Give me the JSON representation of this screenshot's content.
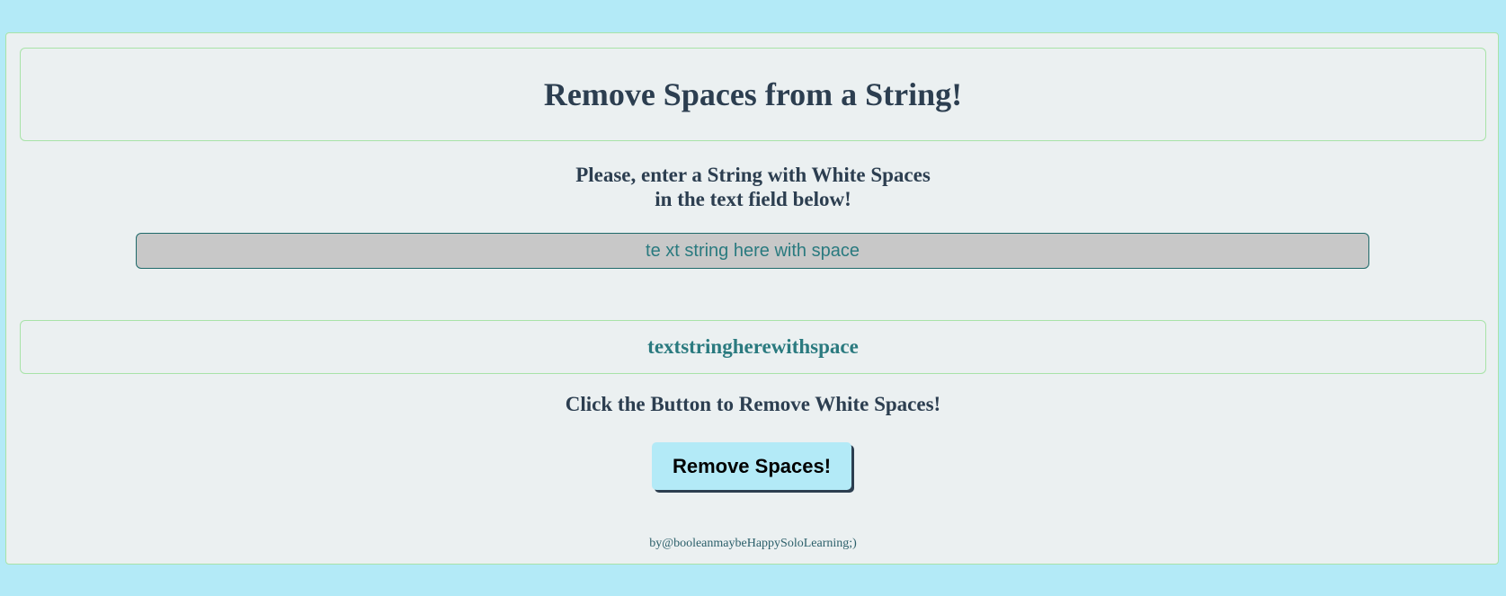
{
  "page": {
    "title": "Remove Spaces from a String!",
    "prompt_line1": "Please, enter a String with White Spaces",
    "prompt_line2": "in the text field below!",
    "input": {
      "value": "te xt string here with space"
    },
    "result": "textstringherewithspace",
    "instruction": "Click the Button to Remove White Spaces!",
    "button_label": "Remove Spaces!",
    "credit": "by@booleanmaybeHappySoloLearning;)"
  },
  "colors": {
    "background": "#b3eaf7",
    "card": "#ebf0f1",
    "border": "#a8e3a8",
    "heading": "#2c3e50",
    "accent": "#2a7a7f",
    "input_bg": "#c8c8c8",
    "button_bg": "#b3eaf7"
  }
}
